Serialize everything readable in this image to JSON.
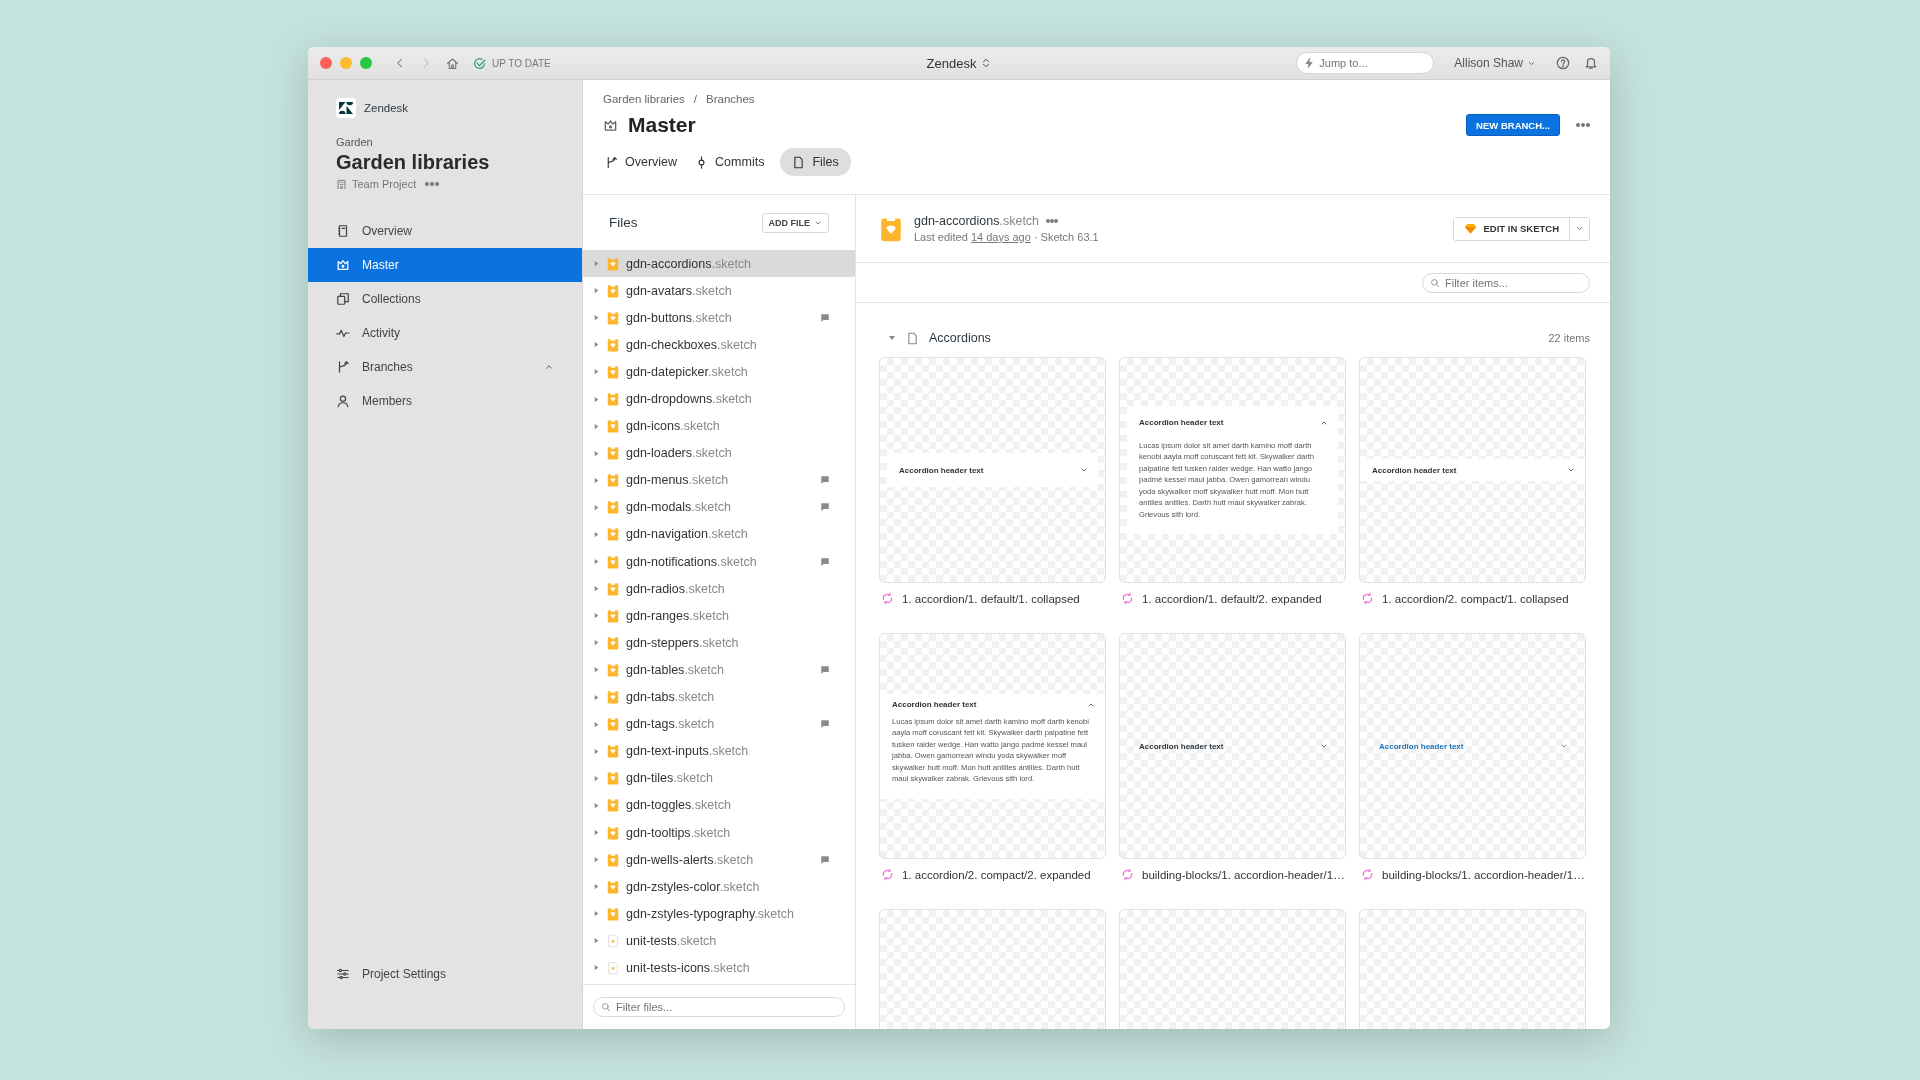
{
  "titlebar": {
    "sync_status": "UP TO DATE",
    "title": "Zendesk",
    "search": {
      "placeholder": "Jump to..."
    },
    "user": "Allison Shaw"
  },
  "sidebar": {
    "org": "Zendesk",
    "group": "Garden",
    "project": "Garden libraries",
    "project_type": "Team Project",
    "nav": [
      {
        "label": "Overview",
        "kind": "page",
        "selected": false
      },
      {
        "label": "Master",
        "kind": "page",
        "selected": true
      },
      {
        "label": "Collections",
        "kind": "page",
        "selected": false
      },
      {
        "label": "Activity",
        "kind": "page",
        "selected": false
      },
      {
        "label": "Branches",
        "kind": "group",
        "expanded": true,
        "selected": false
      },
      {
        "label": "Members",
        "kind": "page",
        "selected": false
      }
    ],
    "footer": "Project Settings"
  },
  "header": {
    "breadcrumbs": [
      "Garden libraries",
      "Branches"
    ],
    "separator": "/",
    "title": "Master",
    "new_button": "NEW BRANCH...",
    "tabs": [
      {
        "label": "Overview",
        "selected": false
      },
      {
        "label": "Commits",
        "selected": false
      },
      {
        "label": "Files",
        "selected": true
      }
    ]
  },
  "files": {
    "title": "Files",
    "add_button": "ADD FILE",
    "filter": {
      "placeholder": "Filter files..."
    },
    "items": [
      {
        "name": "gdn-accordions",
        "ext": ".sketch",
        "kind": "library",
        "comments": false,
        "selected": true
      },
      {
        "name": "gdn-avatars",
        "ext": ".sketch",
        "kind": "library",
        "comments": false,
        "selected": false
      },
      {
        "name": "gdn-buttons",
        "ext": ".sketch",
        "kind": "library",
        "comments": true,
        "selected": false
      },
      {
        "name": "gdn-checkboxes",
        "ext": ".sketch",
        "kind": "library",
        "comments": false,
        "selected": false
      },
      {
        "name": "gdn-datepicker",
        "ext": ".sketch",
        "kind": "library",
        "comments": false,
        "selected": false
      },
      {
        "name": "gdn-dropdowns",
        "ext": ".sketch",
        "kind": "library",
        "comments": false,
        "selected": false
      },
      {
        "name": "gdn-icons",
        "ext": ".sketch",
        "kind": "library",
        "comments": false,
        "selected": false
      },
      {
        "name": "gdn-loaders",
        "ext": ".sketch",
        "kind": "library",
        "comments": false,
        "selected": false
      },
      {
        "name": "gdn-menus",
        "ext": ".sketch",
        "kind": "library",
        "comments": true,
        "selected": false
      },
      {
        "name": "gdn-modals",
        "ext": ".sketch",
        "kind": "library",
        "comments": true,
        "selected": false
      },
      {
        "name": "gdn-navigation",
        "ext": ".sketch",
        "kind": "library",
        "comments": false,
        "selected": false
      },
      {
        "name": "gdn-notifications",
        "ext": ".sketch",
        "kind": "library",
        "comments": true,
        "selected": false
      },
      {
        "name": "gdn-radios",
        "ext": ".sketch",
        "kind": "library",
        "comments": false,
        "selected": false
      },
      {
        "name": "gdn-ranges",
        "ext": ".sketch",
        "kind": "library",
        "comments": false,
        "selected": false
      },
      {
        "name": "gdn-steppers",
        "ext": ".sketch",
        "kind": "library",
        "comments": false,
        "selected": false
      },
      {
        "name": "gdn-tables",
        "ext": ".sketch",
        "kind": "library",
        "comments": true,
        "selected": false
      },
      {
        "name": "gdn-tabs",
        "ext": ".sketch",
        "kind": "library",
        "comments": false,
        "selected": false
      },
      {
        "name": "gdn-tags",
        "ext": ".sketch",
        "kind": "library",
        "comments": true,
        "selected": false
      },
      {
        "name": "gdn-text-inputs",
        "ext": ".sketch",
        "kind": "library",
        "comments": false,
        "selected": false
      },
      {
        "name": "gdn-tiles",
        "ext": ".sketch",
        "kind": "library",
        "comments": false,
        "selected": false
      },
      {
        "name": "gdn-toggles",
        "ext": ".sketch",
        "kind": "library",
        "comments": false,
        "selected": false
      },
      {
        "name": "gdn-tooltips",
        "ext": ".sketch",
        "kind": "library",
        "comments": false,
        "selected": false
      },
      {
        "name": "gdn-wells-alerts",
        "ext": ".sketch",
        "kind": "library",
        "comments": true,
        "selected": false
      },
      {
        "name": "gdn-zstyles-color",
        "ext": ".sketch",
        "kind": "library",
        "comments": false,
        "selected": false
      },
      {
        "name": "gdn-zstyles-typography",
        "ext": ".sketch",
        "kind": "library",
        "comments": false,
        "selected": false
      },
      {
        "name": "unit-tests",
        "ext": ".sketch",
        "kind": "document",
        "comments": false,
        "selected": false
      },
      {
        "name": "unit-tests-icons",
        "ext": ".sketch",
        "kind": "document",
        "comments": false,
        "selected": false
      }
    ]
  },
  "detail": {
    "name": "gdn-accordions",
    "ext": ".sketch",
    "edited_prefix": "Last edited",
    "edited_link": "14 days ago",
    "edited_suffix": "· Sketch 63.1",
    "edit_button": "EDIT IN SKETCH",
    "filter": {
      "placeholder": "Filter items..."
    },
    "section": {
      "title": "Accordions",
      "expanded": true,
      "count": "22 items"
    },
    "artboards": [
      {
        "kind": "collapsed",
        "compact": false,
        "active": false,
        "header": "Accordion header text",
        "name": "1. accordion/1. default/1. collapsed"
      },
      {
        "kind": "expanded",
        "compact": false,
        "active": false,
        "header": "Accordion header text",
        "body": "Lucas ipsum dolor sit amet darth kamino moff darth kenobi aayla moff coruscant fett kit. Skywalker darth palpatine fett tusken raider wedge. Han watto jango padmé kessel maul jabba. Owen gamorrean windu yoda skywalker moff skywalker hutt moff. Mon hutt antilles antilles. Darth hutt maul skywalker zabrak. Grievous sith lord.",
        "name": "1. accordion/1. default/2. expanded"
      },
      {
        "kind": "collapsed",
        "compact": true,
        "active": false,
        "header": "Accordion header text",
        "name": "1. accordion/2. compact/1. collapsed"
      },
      {
        "kind": "expanded",
        "compact": true,
        "active": false,
        "header": "Accordion header text",
        "body": "Lucas ipsum dolor sit amet darth kamino moff darth kenobi aayla moff coruscant fett kit. Skywalker darth palpatine fett tusken raider wedge. Han watto jango padmé kessel maul jabba. Owen gamorrean windu yoda skywalker moff skywalker hutt moff. Mon hutt antilles antilles. Darth hutt maul skywalker zabrak. Grievous sith lord.",
        "name": "1. accordion/2. compact/2. expanded"
      },
      {
        "kind": "header",
        "compact": false,
        "active": false,
        "header": "Accordion header text",
        "name": "building-blocks/1. accordion-header/1…"
      },
      {
        "kind": "header",
        "compact": false,
        "active": true,
        "header": "Accordion header text",
        "name": "building-blocks/1. accordion-header/1…"
      },
      {
        "kind": "blank"
      },
      {
        "kind": "blank"
      },
      {
        "kind": "blank"
      }
    ]
  }
}
